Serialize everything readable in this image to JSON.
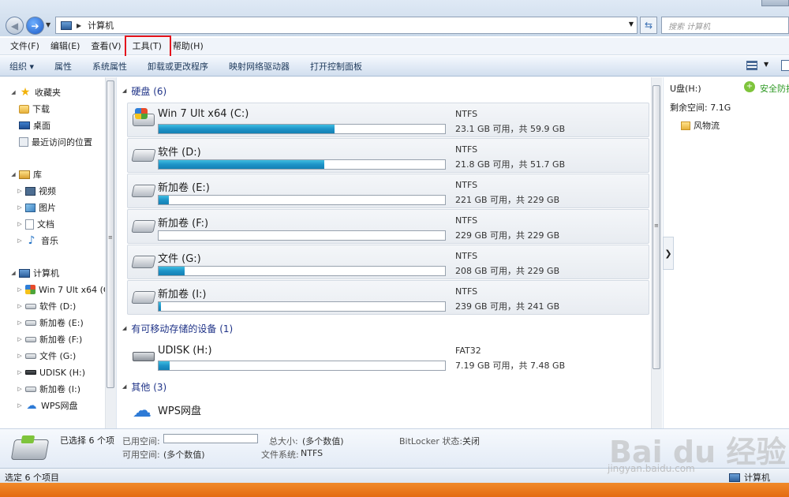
{
  "address": {
    "path_label": "计算机",
    "search_placeholder": "搜索 计算机"
  },
  "menu": [
    "文件(F)",
    "编辑(E)",
    "查看(V)",
    "工具(T)",
    "帮助(H)"
  ],
  "toolbar": [
    "组织 ▾",
    "属性",
    "系统属性",
    "卸载或更改程序",
    "映射网络驱动器",
    "打开控制面板"
  ],
  "nav": {
    "favorites": "收藏夹",
    "fav_items": [
      "下载",
      "桌面",
      "最近访问的位置"
    ],
    "libraries": "库",
    "lib_items": [
      "视频",
      "图片",
      "文档",
      "音乐"
    ],
    "computer": "计算机",
    "pc_items": [
      "Win 7 Ult x64 (C",
      "软件 (D:)",
      "新加卷 (E:)",
      "新加卷 (F:)",
      "文件 (G:)",
      "UDISK (H:)",
      "新加卷 (I:)",
      "WPS网盘"
    ]
  },
  "groups": {
    "hdd": "硬盘 (6)",
    "removable": "有可移动存储的设备 (1)",
    "other": "其他 (3)"
  },
  "drives": [
    {
      "name": "Win 7 Ult x64 (C:)",
      "fs": "NTFS",
      "cap": "23.1 GB 可用，共 59.9 GB",
      "used_fraction": 0.614
    },
    {
      "name": "软件 (D:)",
      "fs": "NTFS",
      "cap": "21.8 GB 可用，共 51.7 GB",
      "used_fraction": 0.578
    },
    {
      "name": "新加卷 (E:)",
      "fs": "NTFS",
      "cap": "221 GB 可用，共 229 GB",
      "used_fraction": 0.035
    },
    {
      "name": "新加卷 (F:)",
      "fs": "NTFS",
      "cap": "229 GB 可用，共 229 GB",
      "used_fraction": 0.0
    },
    {
      "name": "文件 (G:)",
      "fs": "NTFS",
      "cap": "208 GB 可用，共 229 GB",
      "used_fraction": 0.092
    },
    {
      "name": "新加卷 (I:)",
      "fs": "NTFS",
      "cap": "239 GB 可用，共 241 GB",
      "used_fraction": 0.008
    }
  ],
  "usb": {
    "name": "UDISK (H:)",
    "fs": "FAT32",
    "cap": "7.19 GB 可用，共 7.48 GB",
    "used_fraction": 0.039
  },
  "other_item": "WPS网盘",
  "preview": {
    "title": "U盘(H:)",
    "security": "安全防护",
    "free": "剩余空间: 7.1G",
    "folder": "风物流"
  },
  "details": {
    "selected": "已选择 6 个项",
    "used_label": "已用空间:",
    "free_label": "可用空间:",
    "free_value": "(多个数值)",
    "total_label": "总大小:",
    "total_value": "(多个数值)",
    "fs_label": "文件系统:",
    "fs_value": "NTFS",
    "bitlocker_label": "BitLocker 状态:",
    "bitlocker_value": "关闭"
  },
  "status": {
    "left": "选定 6 个项目",
    "right": "计算机"
  },
  "watermark": {
    "main": "Bai du 经验",
    "sub": "jingyan.baidu.com"
  }
}
